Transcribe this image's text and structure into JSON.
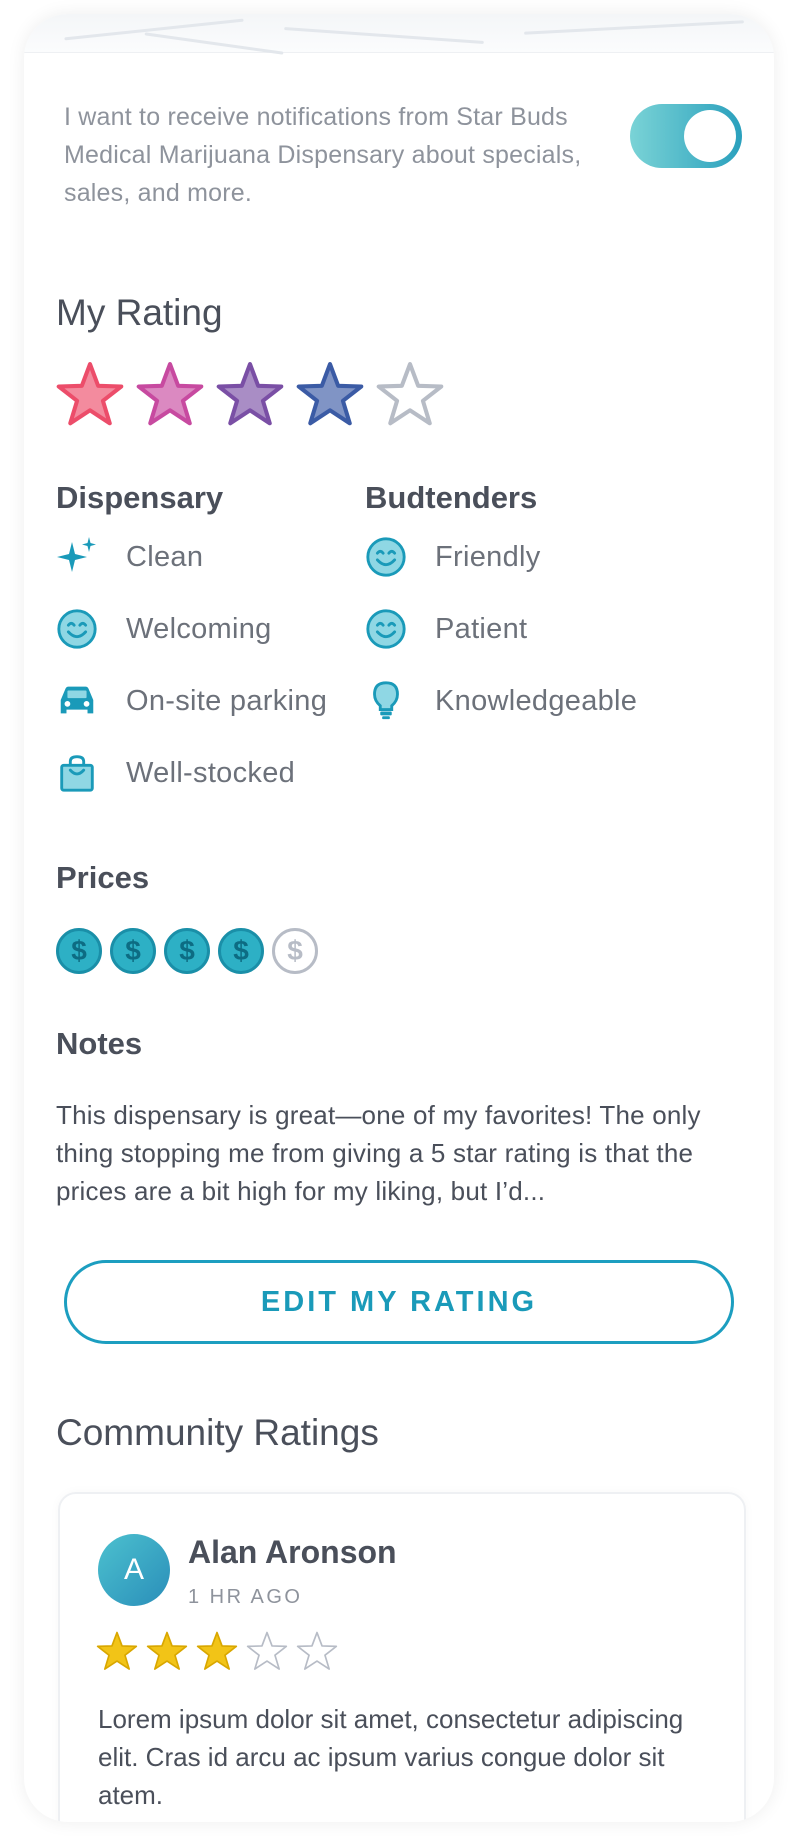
{
  "notification": {
    "text": "I want to receive notifications from Star Buds Medical Marijuana Dispensary about specials, sales, and more.",
    "toggle_on": true
  },
  "my_rating": {
    "heading": "My Rating",
    "stars_filled": 4,
    "stars_total": 5,
    "star_colors": [
      "#ec4d6a",
      "#c74aa0",
      "#7a4fa5",
      "#3b5ba5",
      "#b7bcc6"
    ]
  },
  "dispensary": {
    "heading": "Dispensary",
    "items": [
      {
        "icon": "sparkle-icon",
        "label": "Clean"
      },
      {
        "icon": "smiley-icon",
        "label": "Welcoming"
      },
      {
        "icon": "car-icon",
        "label": "On-site parking"
      },
      {
        "icon": "shopping-bag-icon",
        "label": "Well-stocked"
      }
    ]
  },
  "budtenders": {
    "heading": "Budtenders",
    "items": [
      {
        "icon": "smiley-icon",
        "label": "Friendly"
      },
      {
        "icon": "smiley-icon",
        "label": "Patient"
      },
      {
        "icon": "lightbulb-icon",
        "label": "Knowledgeable"
      }
    ]
  },
  "prices": {
    "heading": "Prices",
    "filled": 4,
    "total": 5,
    "symbol": "$"
  },
  "notes": {
    "heading": "Notes",
    "text": "This dispensary is great—one of my favorites! The only thing stopping me from giving a 5 star rating is that the prices are a bit high for my liking, but I’d..."
  },
  "edit_button": {
    "label": "EDIT MY RATING"
  },
  "community": {
    "heading": "Community Ratings",
    "reviews": [
      {
        "avatar_initial": "A",
        "name": "Alan Aronson",
        "time": "1 HR AGO",
        "stars_filled": 3,
        "stars_total": 5,
        "text": "Lorem ipsum dolor sit amet, consectetur adipiscing elit. Cras id arcu ac ipsum varius congue dolor sit atem."
      }
    ]
  },
  "colors": {
    "accent": "#1a9ab9",
    "icon_teal": "#1a9ab9",
    "gold_star": "#f2c417",
    "muted": "#b7bcc6"
  }
}
